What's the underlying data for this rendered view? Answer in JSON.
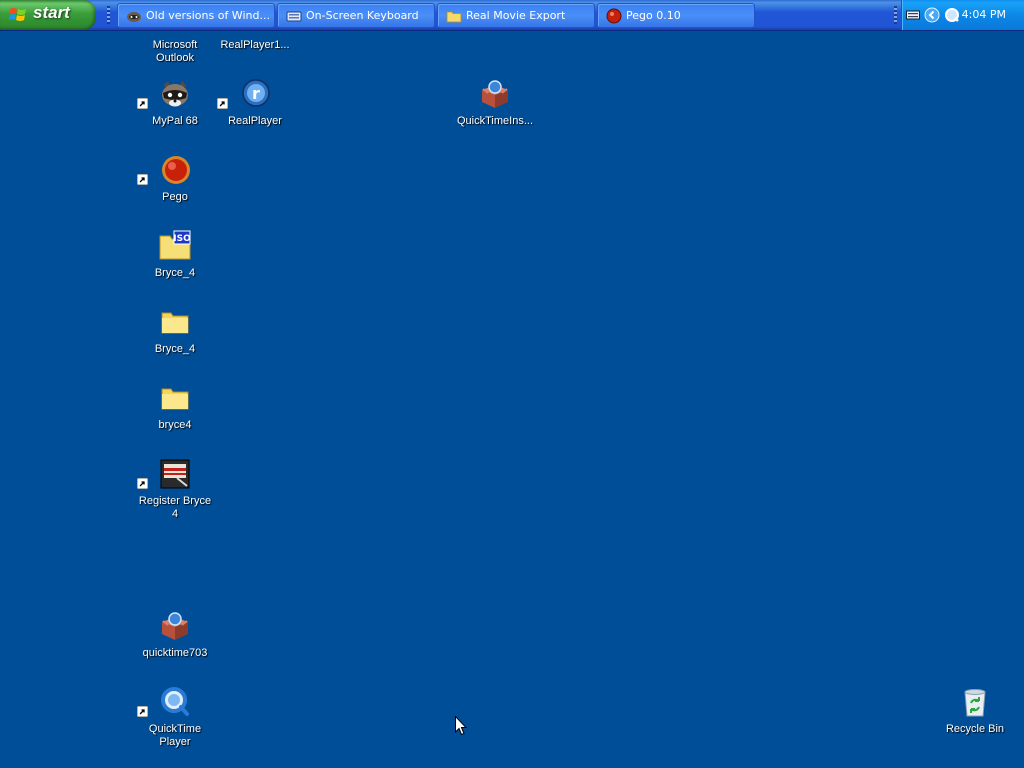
{
  "taskbar": {
    "start_label": "start",
    "tasks": [
      {
        "label": "Old versions of Wind...",
        "icon": "browser-raccoon-icon"
      },
      {
        "label": "On-Screen Keyboard",
        "icon": "keyboard-icon"
      },
      {
        "label": "Real Movie Export",
        "icon": "folder-icon"
      },
      {
        "label": "Pego 0.10",
        "icon": "pego-red-ball-icon"
      }
    ],
    "tray": {
      "clock": "4:04 PM",
      "icons": [
        "keyboard-icon",
        "chevron-left-icon",
        "quicktime-icon"
      ]
    }
  },
  "desktop": {
    "icons": [
      {
        "label": "Microsoft\nOutlook",
        "icon": "outlook-icon"
      },
      {
        "label": "RealPlayer1...",
        "icon": "realplayer-installer-icon"
      },
      {
        "label": "MyPal 68",
        "icon": "raccoon-browser-icon",
        "shortcut": true
      },
      {
        "label": "RealPlayer",
        "icon": "realplayer-icon",
        "shortcut": true
      },
      {
        "label": "QuickTimeIns...",
        "icon": "installer-box-icon"
      },
      {
        "label": "Pego",
        "icon": "pego-red-ball-icon",
        "shortcut": true
      },
      {
        "label": "Bryce_4",
        "icon": "iso-folder-icon"
      },
      {
        "label": "Bryce_4",
        "icon": "folder-icon"
      },
      {
        "label": "bryce4",
        "icon": "folder-icon"
      },
      {
        "label": "Register Bryce\n4",
        "icon": "register-app-icon",
        "shortcut": true
      },
      {
        "label": "quicktime703",
        "icon": "installer-box-icon"
      },
      {
        "label": "QuickTime\nPlayer",
        "icon": "quicktime-icon",
        "shortcut": true
      },
      {
        "label": "Recycle Bin",
        "icon": "recycle-bin-icon"
      }
    ]
  },
  "colors": {
    "desktop": "#004e98",
    "taskbar": "#2157d7",
    "start": "#3a9e3a",
    "tray": "#0c88e8"
  }
}
